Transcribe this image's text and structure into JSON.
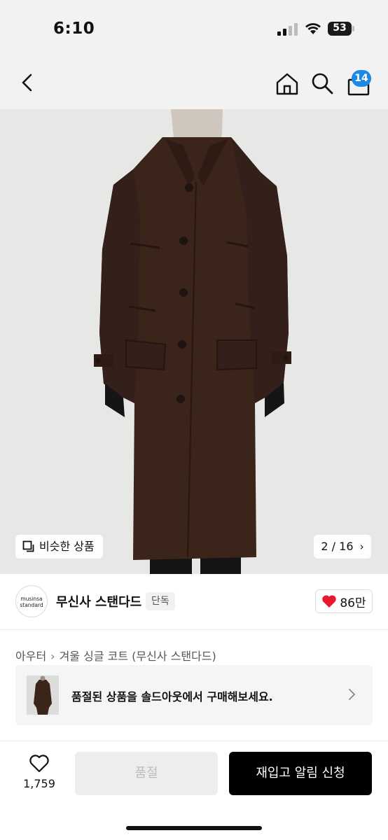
{
  "status_bar": {
    "time": "6:10",
    "battery": "53"
  },
  "nav": {
    "cart_count": "14"
  },
  "product_image": {
    "similar_label": "비슷한 상품",
    "pager": "2 / 16"
  },
  "brand": {
    "logo_line1": "musinsa",
    "logo_line2": "standard",
    "name": "무신사 스탠다드",
    "tag": "단독",
    "likes": "86만"
  },
  "breadcrumb": {
    "category": "아우터",
    "product": "겨울 싱글 코트 (무신사 스탠다드)"
  },
  "soldout_banner": {
    "text": "품절된 상품을 솔드아웃에서 구매해보세요."
  },
  "bottom_bar": {
    "wish_count": "1,759",
    "soldout_label": "품절",
    "restock_label": "재입고 알림 신청"
  },
  "colors": {
    "badge": "#1e88e5",
    "heart": "#e8192c",
    "coat": "#3b2419"
  }
}
